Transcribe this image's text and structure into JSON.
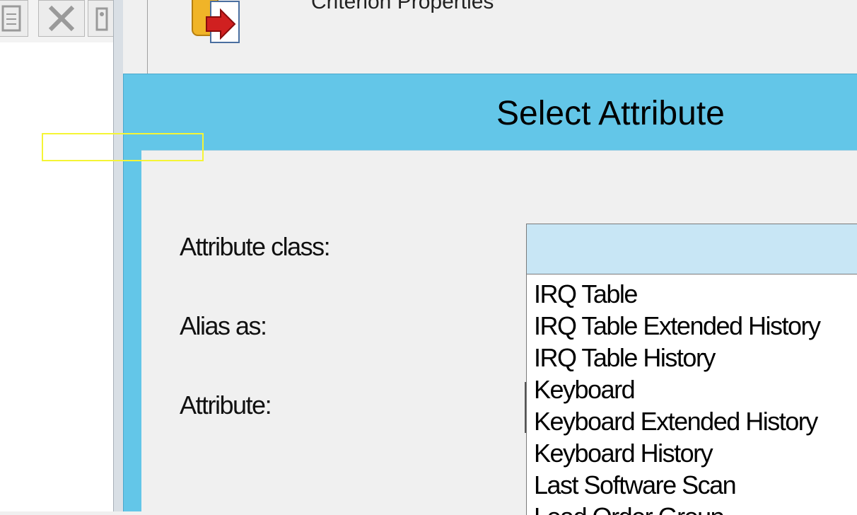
{
  "toolbar": {
    "buttons": [
      {
        "icon": "document-icon"
      },
      {
        "icon": "delete-x-icon"
      },
      {
        "icon": "tool-icon"
      }
    ]
  },
  "background_window": {
    "title": "Criterion Properties",
    "icon": "database-export-icon"
  },
  "dialog": {
    "title": "Select Attribute",
    "title_bar_color": "#63c6e8",
    "labels": {
      "attribute_class": "Attribute class:",
      "alias_as": "Alias as:",
      "attribute": "Attribute:"
    },
    "attribute_class_value": "",
    "dropdown_items": [
      "IRQ Table",
      "IRQ Table Extended History",
      "IRQ Table History",
      "Keyboard",
      "Keyboard Extended History",
      "Keyboard History",
      "Last Software Scan",
      "Load Order Group"
    ]
  }
}
